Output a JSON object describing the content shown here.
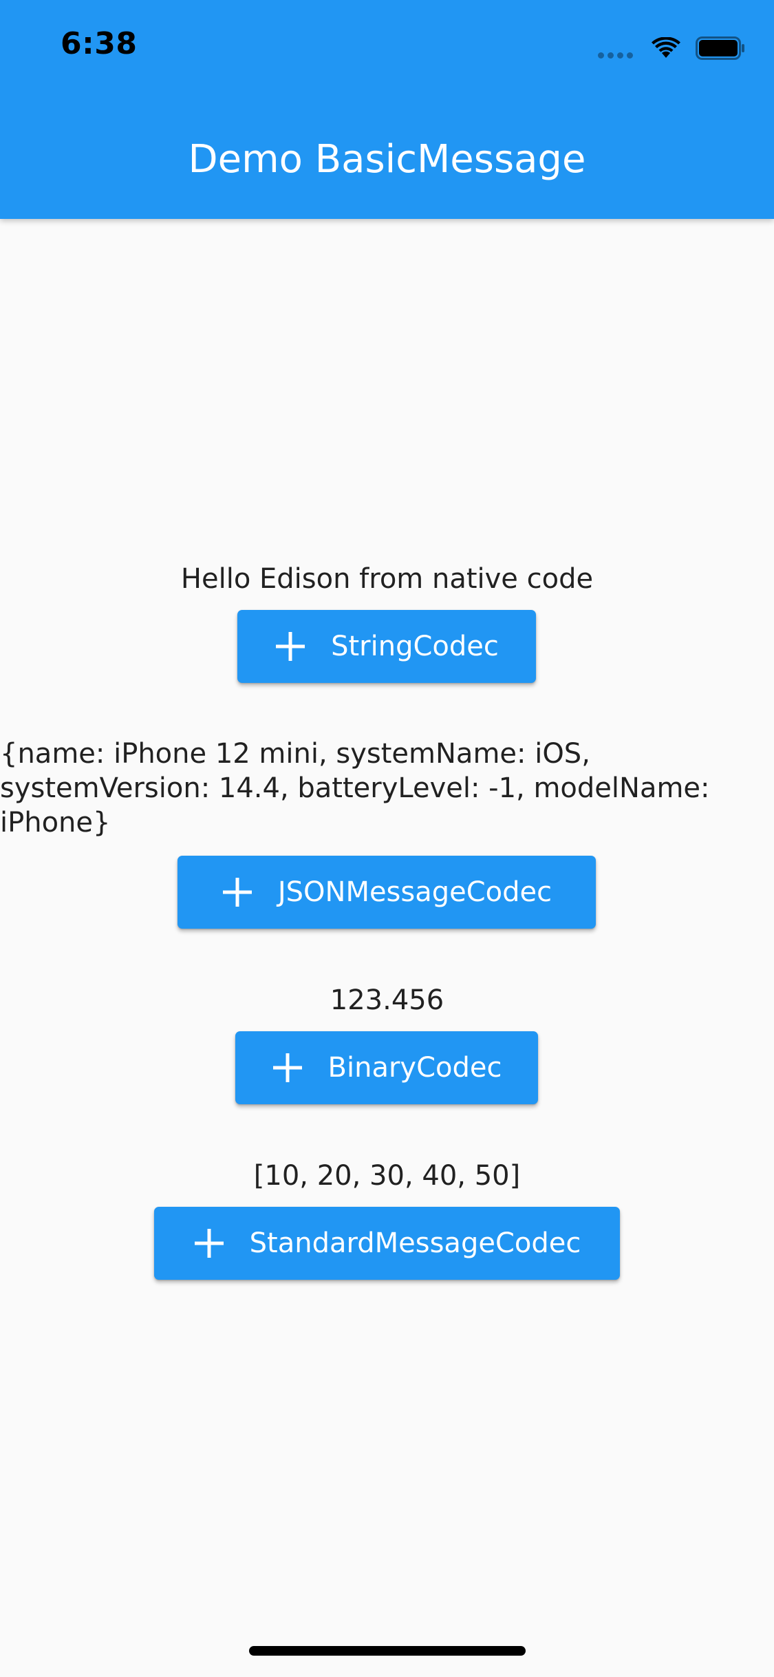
{
  "status_bar": {
    "time": "6:38"
  },
  "app_bar": {
    "title": "Demo BasicMessage",
    "color": "#2196f3"
  },
  "sections": {
    "string": {
      "result": "Hello Edison from native code",
      "button_label": "StringCodec",
      "button_icon": "plus-icon"
    },
    "json": {
      "result": "{name: iPhone 12 mini, systemName: iOS, systemVersion: 14.4, batteryLevel: -1, modelName: iPhone}",
      "button_label": "JSONMessageCodec",
      "button_icon": "plus-icon"
    },
    "binary": {
      "result": "123.456",
      "button_label": "BinaryCodec",
      "button_icon": "plus-icon"
    },
    "standard": {
      "result": "[10, 20, 30, 40, 50]",
      "button_label": "StandardMessageCodec",
      "button_icon": "plus-icon"
    }
  }
}
